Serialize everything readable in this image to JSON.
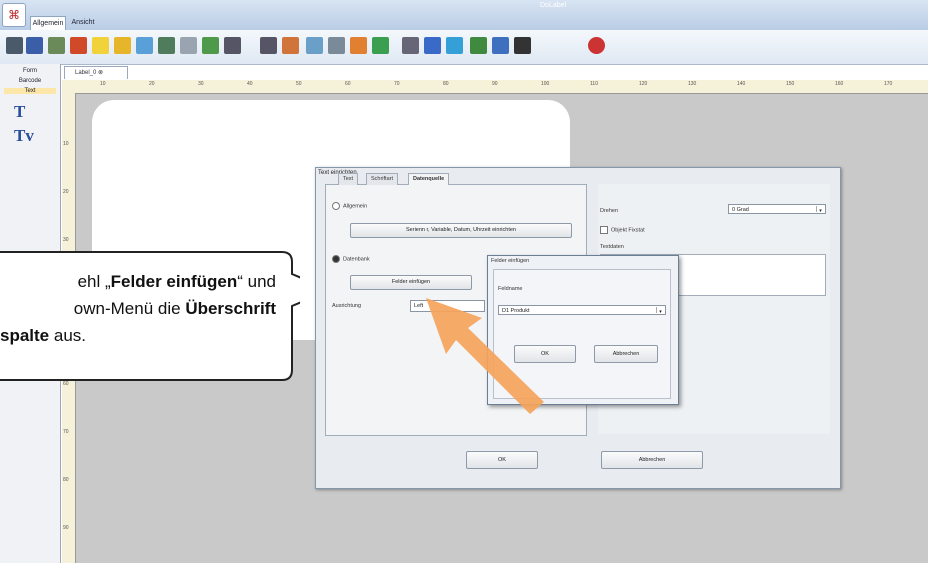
{
  "titlebar": {
    "window_title": "DoLabel",
    "tabs": [
      "Allgemein",
      "Ansicht"
    ]
  },
  "toolbar": {
    "icons": [
      "print-icon",
      "save-icon",
      "user-icon",
      "image-icon",
      "folder-icon",
      "barcode-icon",
      "scissors-icon",
      "tools-icon",
      "grid-icon",
      "eraser-icon",
      "table-icon",
      "chart-icon",
      "cut-icon",
      "pin-icon",
      "undo-icon",
      "redo-icon",
      "frame-icon",
      "page-icon",
      "align-left-icon",
      "align-center-icon",
      "align-right-icon",
      "pointer-icon",
      "delete-icon"
    ]
  },
  "palette": {
    "items": [
      "Form",
      "Barcode",
      "Text"
    ],
    "text_tool": "T",
    "text_var_tool": "Tv"
  },
  "document_tab": "Label_0 ⊗",
  "ruler": {
    "h_ticks": [
      "10",
      "20",
      "30",
      "40",
      "50",
      "60",
      "70",
      "80",
      "90",
      "100",
      "110",
      "120",
      "130",
      "140",
      "150",
      "160",
      "170"
    ],
    "v_ticks": [
      "10",
      "20",
      "30",
      "40",
      "50",
      "60",
      "70",
      "80",
      "90"
    ]
  },
  "dialog": {
    "title": "Text einrichten",
    "tabs": [
      "Text",
      "Schriftart",
      "Datenquelle"
    ],
    "radio_allgemein": "Allgemein",
    "btn_serienfeld": "Serienn r, Variable, Datum, Uhrzeit einrichten",
    "radio_datenbank": "Datenbank",
    "btn_felder": "Felder einfügen",
    "ausrichtung_label": "Ausrichtung",
    "ausrichtung_value": "Left",
    "drehen_label": "Drehen",
    "drehen_value": "0 Grad",
    "objekt_label": "Objekt Fixstat",
    "textdaten_label": "Textdaten",
    "ok": "OK",
    "cancel": "Abbrechen"
  },
  "sub_dialog": {
    "title": "Felder einfügen",
    "field_label": "Feldname",
    "field_value": "D1 Produkt",
    "ok": "OK",
    "cancel": "Abbrechen"
  },
  "callout": {
    "line1_pre": "ehl „",
    "line1_bold": "Felder einfügen",
    "line1_post": "“ und",
    "line2_pre": "own-Menü die ",
    "line2_bold": "Überschrift",
    "line3_bold": "spalte",
    "line3_post": " aus."
  },
  "colors": {
    "accent": "#f5a35a",
    "titlebar": "#b9cde6",
    "canvas": "#c9c9c9"
  }
}
